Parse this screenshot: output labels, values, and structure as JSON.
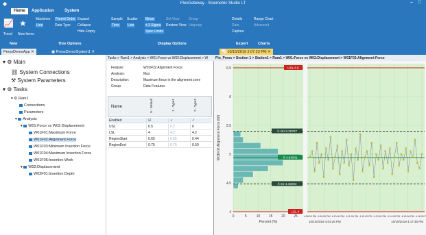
{
  "window": {
    "app_title": "FlexGateway - Sciemetric Studio LT",
    "tabs": [
      "Home",
      "Application",
      "System"
    ]
  },
  "ribbon": {
    "tree_options": [
      "Machines",
      "Parent Order",
      "Expand",
      "Line",
      "Data Type",
      "Collapse",
      "Hide Empty"
    ],
    "new_items": [
      "Trend",
      "New Items"
    ],
    "display_options": [
      "Sample",
      "Scatter",
      "Mean",
      "Set View",
      "Group",
      "Time",
      "Line",
      "± 2 Sigma",
      "Restore View",
      "Ungroup",
      "Spec Limits"
    ],
    "export": [
      "Details",
      "Data",
      "Capture"
    ],
    "charts": [
      "Range Chart",
      "Advanced"
    ],
    "groups": [
      "New",
      "Tree Options",
      "Display Options",
      "Export",
      "Charts"
    ]
  },
  "doc_tabs": [
    "PressDemoApp",
    "PressDemoSystem1",
    "10/15/2019 2:07:23 PM"
  ],
  "tree": {
    "main": "Main",
    "system_connections": "System Connections",
    "system_parameters": "System Parameters",
    "tasks": "Tasks",
    "ram1": "Ram1",
    "connections": "Connections",
    "parameters": "Parameters",
    "analysis": "Analysis",
    "w01_group": "W01:Force vs W02:Displacement",
    "items": [
      "W01F01:Maximum Force",
      "W01F02:Alignment Force",
      "W01F03:Minimum Insertion Force",
      "W01F04:Maximum Insertion Force",
      "W01F05:Insertion Work"
    ],
    "w02": "W02:Displacement",
    "w02_item": "W02F01:Insertion Depth"
  },
  "mid": {
    "breadcrumb": "Tasks > Ram1 > Analysis > W01:Force vs W02:Displacement > W",
    "fields": [
      {
        "k": "Feature:",
        "v": "W01F02:Alignment Force"
      },
      {
        "k": "Analysis:",
        "v": "Max"
      },
      {
        "k": "Description:",
        "v": "Maximum force in the alignment zone"
      },
      {
        "k": "Group:",
        "v": "Data Features"
      }
    ],
    "grid_cols": [
      "Name",
      "0 - Default",
      "1 - Type1",
      "2 - Type2"
    ],
    "rows": [
      {
        "name": "Enabled",
        "c": [
          "☑",
          "✓",
          "✓"
        ]
      },
      {
        "name": "USL",
        "c": [
          "6.5",
          "6.2",
          "6"
        ]
      },
      {
        "name": "LSL",
        "c": [
          "4",
          "4.2",
          "4.2"
        ]
      },
      {
        "name": "RegionStart",
        "c": [
          "0.65",
          "0.65",
          "0.44"
        ]
      },
      {
        "name": "RegionEnd",
        "c": [
          "0.75",
          "0.75",
          "0.59"
        ]
      }
    ]
  },
  "right": {
    "breadcrumb": "Pin_Press > Section 1 > Station1 > Ram1 > W01:Force vs W02:Displacement > W01F02:Alignment Force"
  },
  "chart_data": {
    "type": "scatter",
    "ylabel": "W01F02:Alignment Force (lbf)",
    "xlabel_hist": "Percent (%)",
    "ylim": [
      4,
      6.5
    ],
    "yticks": [
      4,
      4.5,
      5,
      5.5,
      6,
      6.5
    ],
    "hist_xticks": [
      0,
      5,
      10,
      15,
      20,
      25
    ],
    "usl": 6.5,
    "lsl": 4,
    "mean": 4.94041,
    "plus3": 5.39797,
    "minus3": 4.48284,
    "labels": {
      "usl": "USL 6.5",
      "lsl": "LSL 4",
      "mean": "X̄ 4.94041",
      "plus3": "X̄+3σ 5.39797",
      "minus3": "X̄-3σ 4.48284"
    },
    "hist": [
      {
        "lo": 4.4,
        "hi": 4.5,
        "pct": 2
      },
      {
        "lo": 4.5,
        "hi": 4.6,
        "pct": 4
      },
      {
        "lo": 4.6,
        "hi": 4.7,
        "pct": 8
      },
      {
        "lo": 4.7,
        "hi": 4.8,
        "pct": 14
      },
      {
        "lo": 4.8,
        "hi": 4.9,
        "pct": 20
      },
      {
        "lo": 4.9,
        "hi": 5.0,
        "pct": 27
      },
      {
        "lo": 5.0,
        "hi": 5.1,
        "pct": 18
      },
      {
        "lo": 5.1,
        "hi": 5.2,
        "pct": 11
      },
      {
        "lo": 5.2,
        "hi": 5.3,
        "pct": 4
      },
      {
        "lo": 5.3,
        "hi": 5.4,
        "pct": 3
      }
    ],
    "time_ticks": [
      "4:08:00 PM",
      "4:09:00 PM",
      "4:10:00 PM",
      "4:11:00 PM",
      "4:12:00 PM",
      "4:13:00 PM",
      "4:14:00 PM",
      "4:15:00 PM",
      "4:16:00 PM"
    ],
    "time_range": [
      "10/10/2019 4:04:26 PM",
      "10/10/2019 4:17:45 PM"
    ],
    "points": [
      4.95,
      5.05,
      4.7,
      5.2,
      4.85,
      5.0,
      4.6,
      5.1,
      4.9,
      5.3,
      4.75,
      4.95,
      5.15,
      4.65,
      5.05,
      4.85,
      5.25,
      4.8,
      5.0,
      4.55,
      5.1,
      4.9,
      5.35,
      4.7,
      4.95,
      5.05,
      4.8,
      5.2,
      4.6,
      5.0,
      4.9,
      5.15,
      4.75,
      5.05,
      4.85,
      5.1,
      4.65,
      4.95,
      5.2,
      4.8,
      5.0,
      4.9,
      5.1,
      4.7,
      5.05,
      4.95,
      5.25,
      4.85,
      4.75,
      5.0
    ]
  },
  "colors": {
    "accent": "#2b77be",
    "chart_bg": "#d8f0d0",
    "spec": "#cc2222",
    "mean": "#1a8a4a",
    "points": "#e6d21e",
    "hist": "#5ab0b0"
  }
}
